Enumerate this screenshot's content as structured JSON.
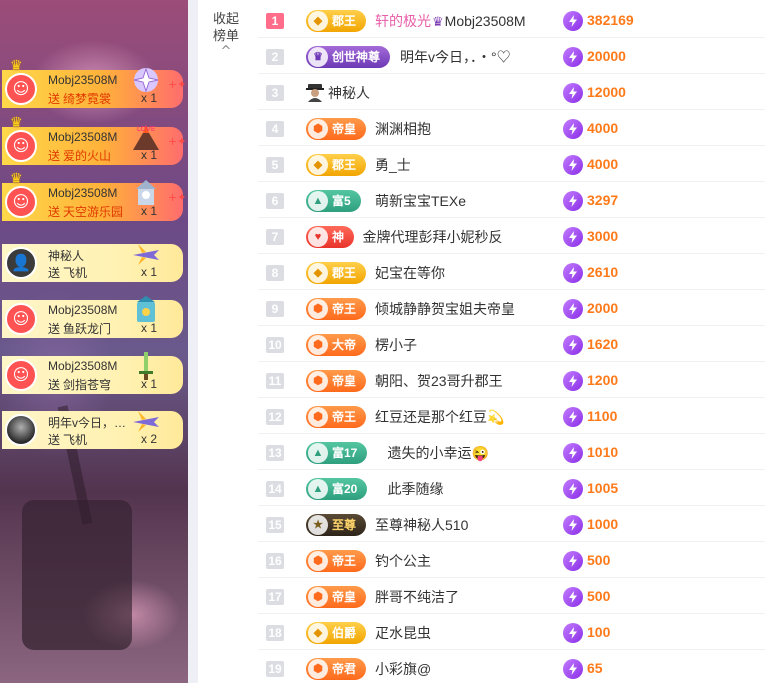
{
  "collapse": {
    "label_line1": "收起",
    "label_line2": "榜单",
    "chevron": "^"
  },
  "gifts": [
    {
      "user": "Mobj23508M",
      "verb": "送",
      "gift": "绮梦霓裳",
      "count": "x 1",
      "style": "hot",
      "avatar": "smiley",
      "crown": true,
      "icon": "fairy-gift-icon"
    },
    {
      "user": "Mobj23508M",
      "verb": "送",
      "gift": "爱的火山",
      "count": "x 1",
      "style": "hot",
      "avatar": "smiley",
      "crown": true,
      "icon": "volcano-gift-icon"
    },
    {
      "user": "Mobj23508M",
      "verb": "送",
      "gift": "天空游乐园",
      "count": "x 1",
      "style": "hot",
      "avatar": "smiley",
      "crown": true,
      "icon": "sky-park-gift-icon"
    },
    {
      "user": "神秘人",
      "verb": "送",
      "gift": "飞机",
      "count": "x 1",
      "style": "cream",
      "avatar": "mystery",
      "crown": false,
      "icon": "plane-gift-icon"
    },
    {
      "user": "Mobj23508M",
      "verb": "送",
      "gift": "鱼跃龙门",
      "count": "x 1",
      "style": "cream",
      "avatar": "smiley",
      "crown": false,
      "icon": "dragon-gate-gift-icon"
    },
    {
      "user": "Mobj23508M",
      "verb": "送",
      "gift": "剑指苍穹",
      "count": "x 1",
      "style": "cream",
      "avatar": "smiley",
      "crown": false,
      "icon": "sword-gift-icon"
    },
    {
      "user": "明年v今日，…",
      "verb": "送",
      "gift": "飞机",
      "count": "x 2",
      "style": "cream",
      "avatar": "photo",
      "crown": false,
      "icon": "plane-gift-icon"
    }
  ],
  "ranking": [
    {
      "rank": "1",
      "badge": "郡王",
      "badge_style": "gold",
      "name": "轩的极光",
      "name_extra": "Mobj23508M",
      "pink": true,
      "score": "382169"
    },
    {
      "rank": "2",
      "badge": "创世神尊",
      "badge_style": "purple",
      "name": "明年v今日，．・°♡",
      "pink": false,
      "score": "20000"
    },
    {
      "rank": "3",
      "badge": "",
      "badge_style": "mystery",
      "name": "神秘人",
      "pink": false,
      "score": "12000"
    },
    {
      "rank": "4",
      "badge": "帝皇",
      "badge_style": "orange",
      "name": "渊渊相抱",
      "pink": false,
      "score": "4000"
    },
    {
      "rank": "5",
      "badge": "郡王",
      "badge_style": "gold",
      "name": "勇_士",
      "pink": false,
      "score": "4000"
    },
    {
      "rank": "6",
      "badge": "富5",
      "badge_style": "teal",
      "name": "萌新宝宝TEXe",
      "pink": false,
      "score": "3297"
    },
    {
      "rank": "7",
      "badge": "神",
      "badge_style": "red",
      "name": "金牌代理彭拜小妮秒反",
      "pink": false,
      "score": "3000"
    },
    {
      "rank": "8",
      "badge": "郡王",
      "badge_style": "gold",
      "name": "妃宝在等你",
      "pink": false,
      "score": "2610"
    },
    {
      "rank": "9",
      "badge": "帝王",
      "badge_style": "orange",
      "name": "倾城静静贺宝姐夫帝皇",
      "pink": false,
      "score": "2000"
    },
    {
      "rank": "10",
      "badge": "大帝",
      "badge_style": "orange",
      "name": "楞小子",
      "pink": false,
      "score": "1620"
    },
    {
      "rank": "11",
      "badge": "帝皇",
      "badge_style": "orange",
      "name": "朝阳、贺23哥升郡王",
      "pink": false,
      "score": "1200"
    },
    {
      "rank": "12",
      "badge": "帝王",
      "badge_style": "orange",
      "name": "红豆还是那个红豆💫",
      "pink": false,
      "score": "1100"
    },
    {
      "rank": "13",
      "badge": "富17",
      "badge_style": "teal",
      "name": "遗失的小幸运😜",
      "pink": false,
      "score": "1010"
    },
    {
      "rank": "14",
      "badge": "富20",
      "badge_style": "teal",
      "name": "此季随缘",
      "pink": false,
      "score": "1005"
    },
    {
      "rank": "15",
      "badge": "至尊",
      "badge_style": "dark",
      "name": "至尊神秘人510",
      "pink": false,
      "score": "1000"
    },
    {
      "rank": "16",
      "badge": "帝王",
      "badge_style": "orange",
      "name": "钓个公主",
      "pink": false,
      "score": "500"
    },
    {
      "rank": "17",
      "badge": "帝皇",
      "badge_style": "orange",
      "name": "胖哥不纯洁了",
      "pink": false,
      "score": "500"
    },
    {
      "rank": "18",
      "badge": "伯爵",
      "badge_style": "gold",
      "name": "疋水昆虫",
      "pink": false,
      "score": "100"
    },
    {
      "rank": "19",
      "badge": "帝君",
      "badge_style": "orange",
      "name": "小彩旗@",
      "pink": false,
      "score": "65"
    }
  ]
}
